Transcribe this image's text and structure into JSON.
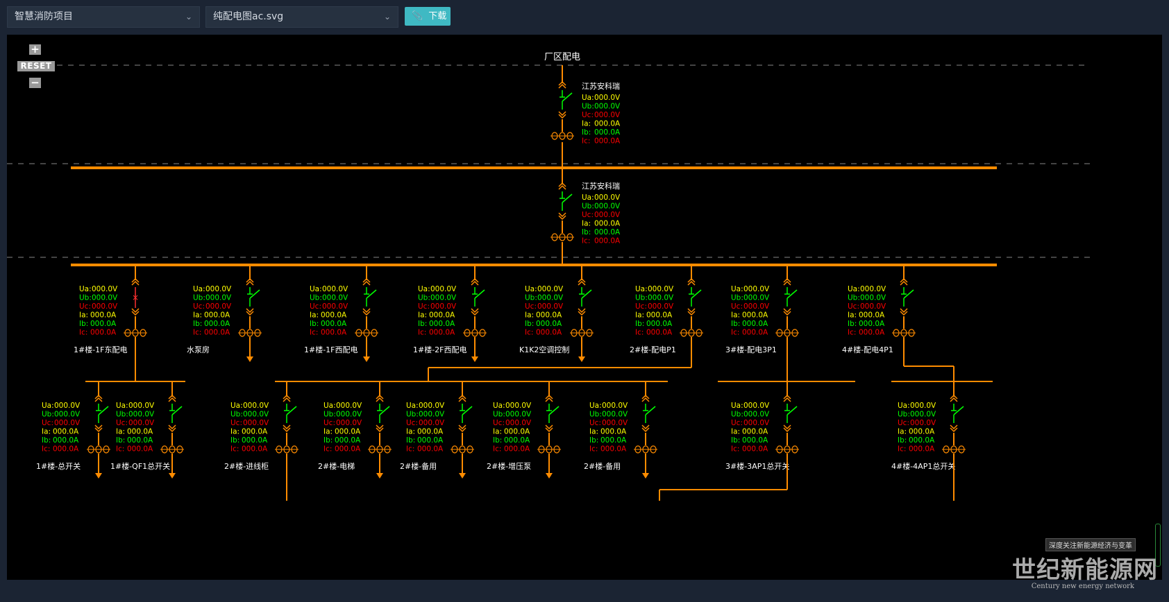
{
  "toolbar": {
    "project_select": "智慧消防项目",
    "file_select": "纯配电图ac.svg",
    "download_label": "下载"
  },
  "zoom": {
    "in": "+",
    "reset": "RESET",
    "out": "−"
  },
  "diagram": {
    "title": "厂区配电",
    "meter_labels": [
      "Ua:",
      "Ub:",
      "Uc:",
      "Ia:",
      "Ib:",
      "Ic:"
    ],
    "voltage_value": "000.0V",
    "current_value": "000.0A",
    "colors": {
      "Ua": "#ffff00",
      "Ub": "#00ff00",
      "Uc": "#ff0000",
      "Ia": "#ffff00",
      "Ib": "#00ff00",
      "Ic": "#ff0000",
      "line": "#ff8c00",
      "switch": "#00ff00"
    },
    "incomers": [
      {
        "name": "江苏安科瑞"
      },
      {
        "name": "江苏安科瑞"
      }
    ],
    "feeders_level1": [
      {
        "label": "1#楼-1F东配电",
        "tripped": true
      },
      {
        "label": "水泵房"
      },
      {
        "label": "1#楼-1F西配电"
      },
      {
        "label": "1#楼-2F西配电"
      },
      {
        "label": "K1K2空调控制"
      },
      {
        "label": "2#楼-配电P1"
      },
      {
        "label": "3#楼-配电3P1"
      },
      {
        "label": "4#楼-配电4P1"
      }
    ],
    "feeders_level2": [
      {
        "label": "1#楼-总开关"
      },
      {
        "label": "1#楼-QF1总开关"
      },
      {
        "label": "2#楼-进线柜"
      },
      {
        "label": "2#楼-电梯"
      },
      {
        "label": "2#楼-备用"
      },
      {
        "label": "2#楼-增压泵"
      },
      {
        "label": "2#楼-备用"
      },
      {
        "label": "3#楼-3AP1总开关"
      },
      {
        "label": "4#楼-4AP1总开关"
      }
    ]
  },
  "watermark": {
    "tag": "深度关注新能源经济与变革",
    "title": "世纪新能源网",
    "subtitle": "Century new energy network"
  }
}
